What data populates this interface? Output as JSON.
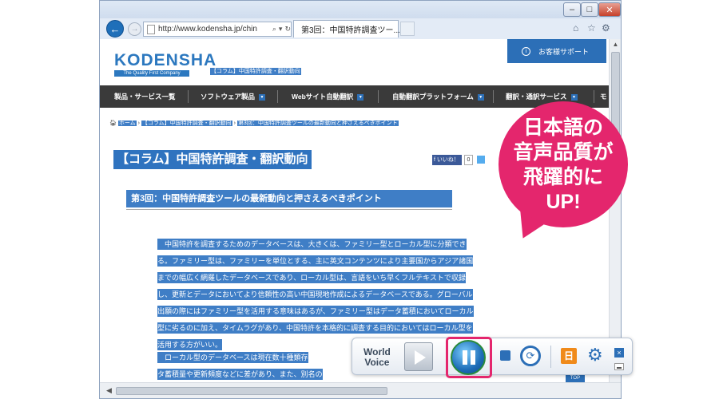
{
  "browser": {
    "url": "http://www.kodensha.jp/chin",
    "tab_title": "第3回：中国特許調査ツー...",
    "back_icon": "back-arrow-icon",
    "forward_icon": "forward-arrow-icon"
  },
  "site": {
    "logo_name": "KODENSHA",
    "logo_tagline": "The Quality First Company",
    "top_breadcrumb": "【コラム】中国特許調査・翻訳動向",
    "support_label": "お客様サポート",
    "support_icon_glyph": "i",
    "menu": [
      {
        "label": "製品・サービス一覧",
        "dropdown": false
      },
      {
        "label": "ソフトウェア製品",
        "dropdown": true
      },
      {
        "label": "Webサイト自動翻訳",
        "dropdown": true
      },
      {
        "label": "自動翻訳プラットフォーム",
        "dropdown": true
      },
      {
        "label": "翻訳・通訳サービス",
        "dropdown": true
      },
      {
        "label": "モ",
        "dropdown": false
      }
    ],
    "breadcrumb": {
      "home": "ホーム",
      "sep": "›",
      "column": "【コラム】中国特許調査・翻訳動向",
      "current": "第3回：中国特許調査ツールの最新動向と押さえるべきポイント"
    }
  },
  "article": {
    "title": "【コラム】中国特許調査・翻訳動向",
    "like_label": "いいね！",
    "like_count": "0",
    "subtitle": "第3回：中国特許調査ツールの最新動向と押さえるべきポイント",
    "paragraph1_lines": [
      "　中国特許を調査するためのデータベースは、大きくは、ファミリー型とローカル型に分類でき",
      "る。ファミリー型は、ファミリーを単位とする、主に英文コンテンツにより主要国からアジア諸国",
      "までの幅広く網羅したデータベースであり、ローカル型は、言語をいち早くフルテキストで収録",
      "し、更新とデータにおいてより信頼性の高い中国現地作成によるデータベースである。グローバル",
      "出願の際にはファミリー型を活用する意味はあるが、ファミリー型はデータ蓄積においてローカル",
      "型に劣るのに加え、タイムラグがあり、中国特許を本格的に調査する目的においてはローカル型を",
      "活用する方がいい。"
    ],
    "paragraph2_lines": [
      "　ローカル型のデータベースは現在数十種類存",
      "タ蓄積量や更新頻度などに差があり、また、別名の"
    ],
    "top_link": "TOP"
  },
  "callout": {
    "lines": [
      "日本語の",
      "音声品質が",
      "飛躍的に",
      "UP!"
    ]
  },
  "worldvoice": {
    "label_line1": "World",
    "label_line2": "Voice",
    "lang_label": "日",
    "repeat_glyph": "⟳",
    "gear_glyph": "⚙",
    "close_glyph": "×",
    "state": "playing",
    "colors": {
      "highlight": "#e4266d",
      "accent": "#2c6fb7",
      "lang": "#f08a1a"
    }
  },
  "colors": {
    "selection": "#3f7ec6",
    "menu_bg": "#3a3a3a",
    "callout": "#e4266d",
    "brand": "#2c78bf"
  }
}
